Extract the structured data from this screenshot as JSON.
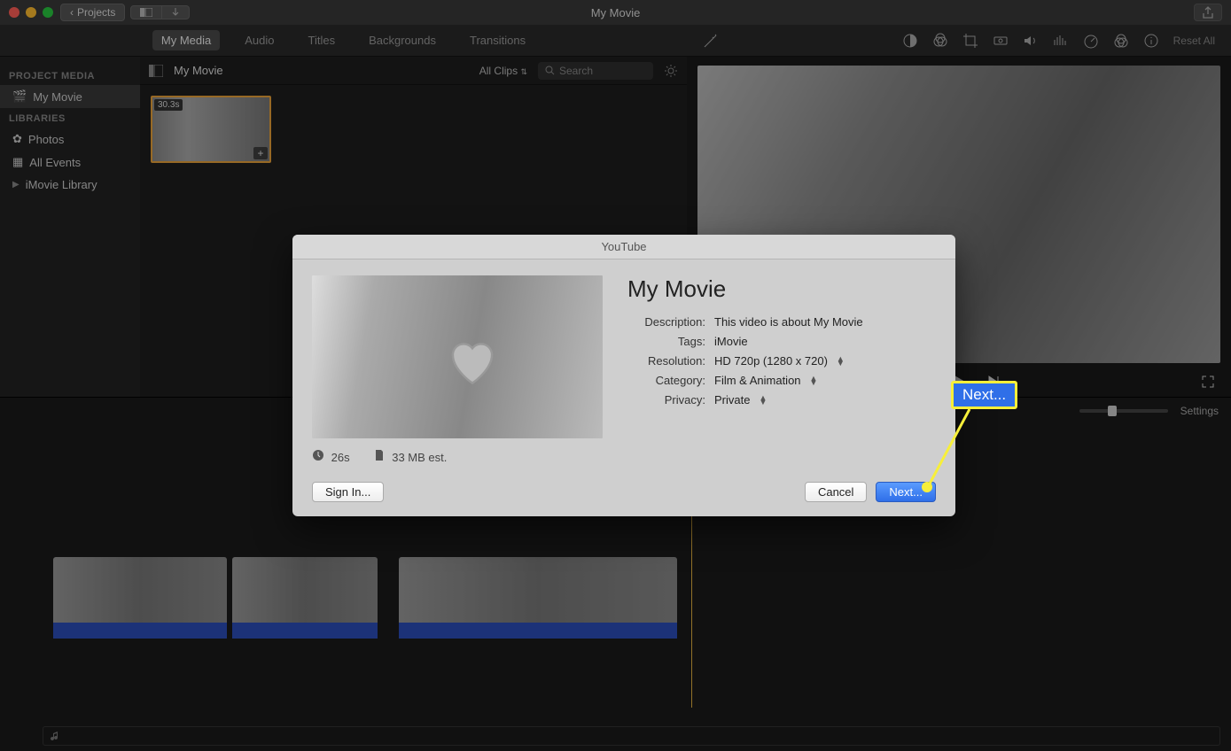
{
  "titlebar": {
    "projects_btn": "Projects",
    "window_title": "My Movie"
  },
  "tabs": {
    "items": [
      "My Media",
      "Audio",
      "Titles",
      "Backgrounds",
      "Transitions"
    ],
    "active_index": 0,
    "reset_all": "Reset All"
  },
  "sidebar": {
    "header1": "PROJECT MEDIA",
    "project": "My Movie",
    "header2": "LIBRARIES",
    "photos": "Photos",
    "all_events": "All Events",
    "library": "iMovie Library"
  },
  "browser": {
    "project_name": "My Movie",
    "clips_selector": "All Clips",
    "search_placeholder": "Search",
    "clip_duration": "30.3s"
  },
  "timeline": {
    "settings_label": "Settings"
  },
  "modal": {
    "title": "YouTube",
    "movie_title": "My Movie",
    "fields": {
      "description_label": "Description:",
      "description_value": "This video is about My Movie",
      "tags_label": "Tags:",
      "tags_value": "iMovie",
      "resolution_label": "Resolution:",
      "resolution_value": "HD 720p (1280 x 720)",
      "category_label": "Category:",
      "category_value": "Film & Animation",
      "privacy_label": "Privacy:",
      "privacy_value": "Private"
    },
    "duration": "26s",
    "filesize": "33 MB est.",
    "signin_btn": "Sign In...",
    "cancel_btn": "Cancel",
    "next_btn": "Next..."
  },
  "annotation": {
    "callout_label": "Next..."
  }
}
